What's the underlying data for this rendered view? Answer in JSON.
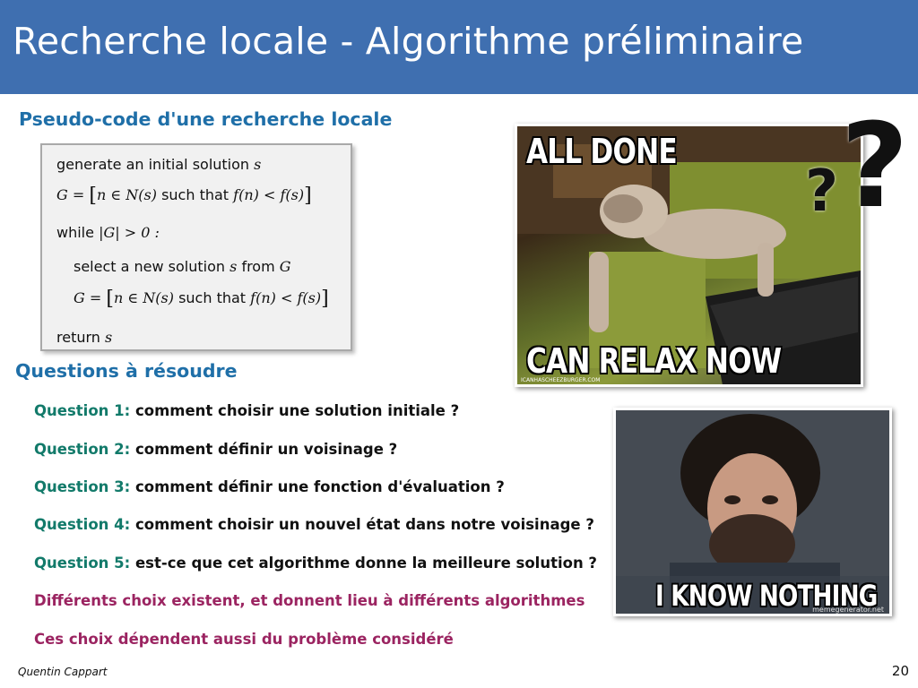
{
  "slide": {
    "title": "Recherche locale - Algorithme préliminaire",
    "accent_color": "#3f6fb0"
  },
  "pseudocode": {
    "heading": "Pseudo-code d'une recherche locale",
    "lines": [
      {
        "text": "generate an initial solution",
        "var": "s"
      },
      {
        "lhs": "G =",
        "set_open": "[",
        "member": "n ∈ N(s)",
        "such": "such that",
        "cond": "f(n) < f(s)",
        "set_close": "]"
      },
      {
        "kw": "while",
        "cond": "|G| > 0 :"
      },
      {
        "text": "select a new solution",
        "var": "s",
        "from": "from",
        "src": "G"
      },
      {
        "lhs": "G =",
        "set_open": "[",
        "member": "n ∈ N(s)",
        "such": "such that",
        "cond": "f(n) < f(s)",
        "set_close": "]"
      },
      {
        "text": "return",
        "var": "s"
      }
    ]
  },
  "questions": {
    "heading": "Questions à résoudre",
    "items": [
      {
        "label": "Question 1:",
        "text": "comment choisir une solution initiale ?"
      },
      {
        "label": "Question 2:",
        "text": "comment définir un voisinage ?"
      },
      {
        "label": "Question 3:",
        "text": "comment définir une fonction d'évaluation ?"
      },
      {
        "label": "Question 4:",
        "text": "comment choisir un nouvel état dans notre voisinage ?"
      },
      {
        "label": "Question 5:",
        "text": "est-ce que cet algorithme donne la meilleure solution ?"
      }
    ],
    "notes": [
      "Différents choix existent, et donnent lieu à différents algorithmes",
      "Ces choix dépendent aussi du problème considéré"
    ]
  },
  "memes": {
    "cat": {
      "top": "ALL DONE",
      "bottom": "CAN RELAX NOW",
      "credit": "ICANHASCHEEZBURGER.COM"
    },
    "jon": {
      "bottom": "I KNOW NOTHING",
      "credit": "memegenerator.net"
    }
  },
  "footer": {
    "author": "Quentin Cappart",
    "page": "20"
  }
}
